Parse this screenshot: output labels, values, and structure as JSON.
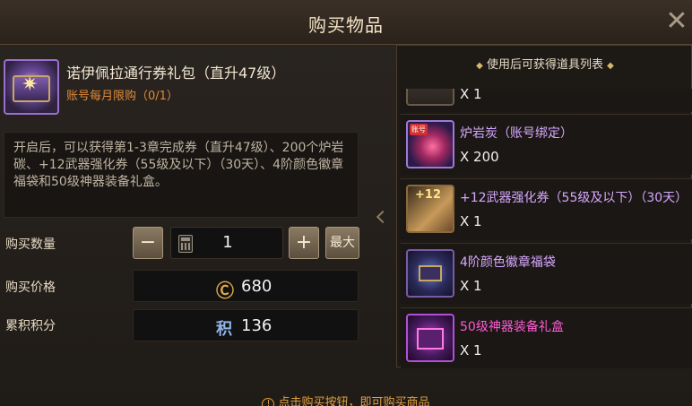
{
  "window": {
    "title": "购买物品"
  },
  "item": {
    "name": "诺伊佩拉通行券礼包（直升47级）",
    "limit": "账号每月限购（0/1）",
    "description": "开启后，可以获得第1-3章完成券（直升47级）、200个炉岩碳、+12武器强化券（55级及以下）（30天）、4阶颜色徽章福袋和50级神器装备礼盒。",
    "icon": "gift-box-icon"
  },
  "purchase": {
    "quantity_label": "购买数量",
    "quantity_value": "1",
    "minus_label": "−",
    "plus_label": "+",
    "max_label": "最大",
    "price_label": "购买价格",
    "price_value": "680",
    "price_icon": "Ⓒ",
    "points_label": "累积积分",
    "points_icon": "积",
    "points_value": "136"
  },
  "rewards": {
    "header": "使用后可获得道具列表",
    "header_diamond": "◆",
    "items": [
      {
        "name": "",
        "qty": "X 1",
        "icon": "partial-item-icon"
      },
      {
        "name": "炉岩炭（账号绑定）",
        "qty": "X 200",
        "icon": "furnace-coal-icon",
        "tag": "账号"
      },
      {
        "name": "+12武器强化券（55级及以下）（30天）",
        "qty": "X 1",
        "icon": "upgrade-scroll-icon",
        "badge": "+12"
      },
      {
        "name": "4阶颜色徽章福袋",
        "qty": "X 1",
        "icon": "emblem-bag-icon"
      },
      {
        "name": "50级神器装备礼盒",
        "qty": "X 1",
        "icon": "artifact-box-icon"
      }
    ]
  },
  "footer": {
    "hint": "点击购买按钮，即可购买商品",
    "hint_icon": "!"
  },
  "colors": {
    "accent": "#e2a040",
    "epic": "#d6a8ff",
    "legendary": "#ff5bd6"
  }
}
